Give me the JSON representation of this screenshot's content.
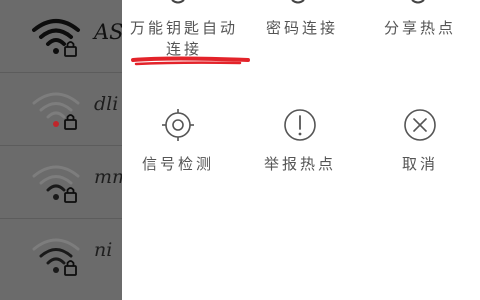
{
  "wifi_list": [
    {
      "name": "AS",
      "signal": "full",
      "locked": true
    },
    {
      "name": "dli",
      "signal": "weak",
      "locked": true
    },
    {
      "name": "mm",
      "signal": "weak",
      "locked": true
    },
    {
      "name": "ni",
      "signal": "medium",
      "locked": true
    }
  ],
  "actions_top": [
    {
      "label_line1": "万能钥匙自动",
      "label_line2": "连接"
    },
    {
      "label_line1": "密码连接"
    },
    {
      "label_line1": "分享热点"
    }
  ],
  "actions_bottom": [
    {
      "label": "信号检测",
      "icon": "target-icon"
    },
    {
      "label": "举报热点",
      "icon": "exclamation-circle-icon"
    },
    {
      "label": "取消",
      "icon": "close-circle-icon"
    }
  ],
  "colors": {
    "overlay": "#6b6b6b",
    "sheet": "#ffffff",
    "label": "#555555",
    "annotation": "#e3232a"
  }
}
